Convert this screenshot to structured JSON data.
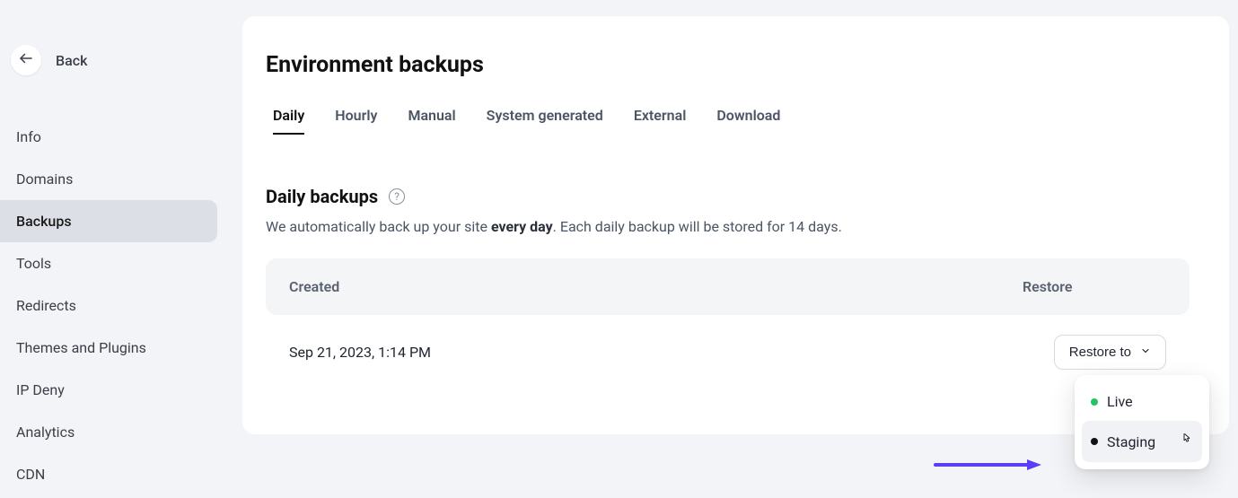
{
  "sidebar": {
    "back_label": "Back",
    "items": [
      {
        "label": "Info"
      },
      {
        "label": "Domains"
      },
      {
        "label": "Backups"
      },
      {
        "label": "Tools"
      },
      {
        "label": "Redirects"
      },
      {
        "label": "Themes and Plugins"
      },
      {
        "label": "IP Deny"
      },
      {
        "label": "Analytics"
      },
      {
        "label": "CDN"
      }
    ],
    "active_index": 2
  },
  "page": {
    "title": "Environment backups"
  },
  "tabs": {
    "items": [
      {
        "label": "Daily"
      },
      {
        "label": "Hourly"
      },
      {
        "label": "Manual"
      },
      {
        "label": "System generated"
      },
      {
        "label": "External"
      },
      {
        "label": "Download"
      }
    ],
    "active_index": 0
  },
  "section": {
    "title": "Daily backups",
    "desc_pre": "We automatically back up your site ",
    "desc_bold": "every day",
    "desc_post": ". Each daily backup will be stored for 14 days."
  },
  "table": {
    "headers": {
      "created": "Created",
      "restore": "Restore"
    },
    "rows": [
      {
        "created": "Sep 21, 2023, 1:14 PM",
        "restore_label": "Restore to"
      }
    ]
  },
  "dropdown": {
    "items": [
      {
        "label": "Live",
        "dot_color": "#22c55e"
      },
      {
        "label": "Staging",
        "dot_color": "#111111"
      }
    ],
    "hover_index": 1
  },
  "colors": {
    "annotation_arrow": "#5b3df5"
  }
}
